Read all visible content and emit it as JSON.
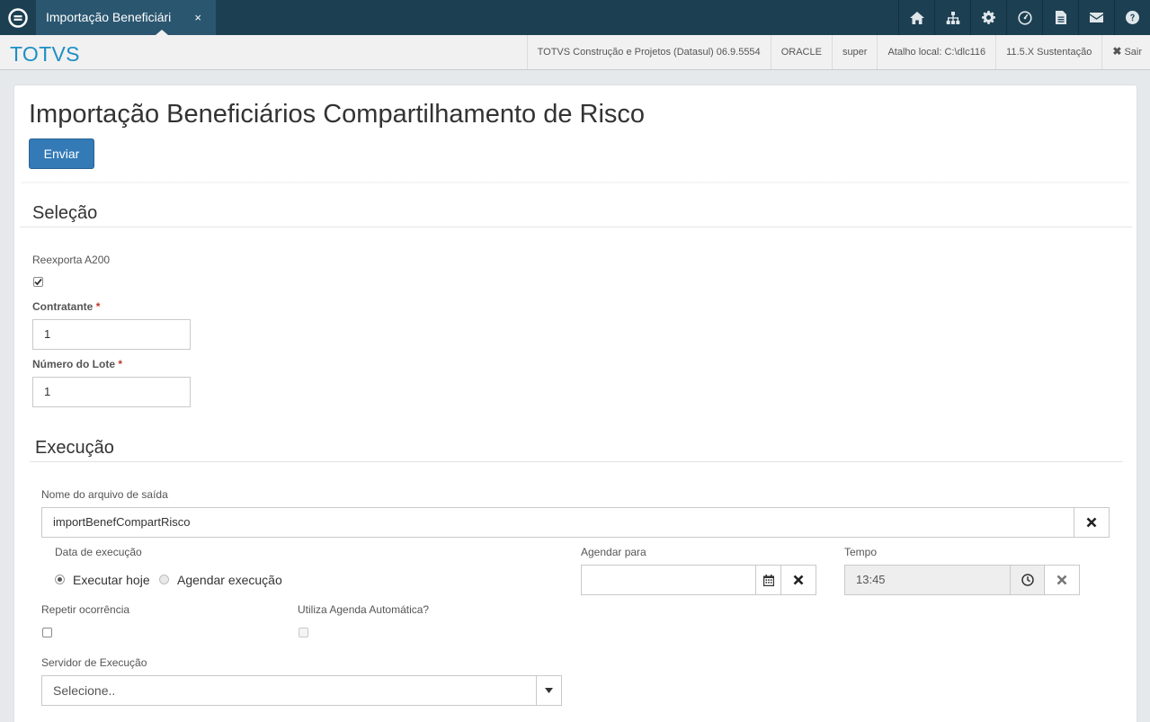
{
  "topbar": {
    "tab_title": "Importação Beneficiári",
    "tab_close": "×",
    "icons": [
      "home-icon",
      "sitemap-icon",
      "gear-icon",
      "dashboard-icon",
      "document-icon",
      "mail-icon",
      "help-icon"
    ]
  },
  "subheader": {
    "brand": "TOTVS",
    "product": "TOTVS Construção e Projetos (Datasul) 06.9.5554",
    "database": "ORACLE",
    "user": "super",
    "shortcut": "Atalho local: C:\\dlc116",
    "version": "11.5.X Sustentação",
    "logout": "Sair"
  },
  "page": {
    "title": "Importação Beneficiários Compartilhamento de Risco",
    "send_label": "Enviar"
  },
  "selecao": {
    "title": "Seleção",
    "reexporta_label": "Reexporta A200",
    "reexporta_checked": true,
    "contratante_label": "Contratante",
    "contratante_value": "1",
    "lote_label": "Número do Lote",
    "lote_value": "1",
    "required_mark": "*"
  },
  "execucao": {
    "title": "Execução",
    "output_label": "Nome do arquivo de saída",
    "output_value": "importBenefCompartRisco",
    "data_label": "Data de execução",
    "radio_today": "Executar hoje",
    "radio_schedule": "Agendar execução",
    "selected_option": "Executar hoje",
    "agendar_label": "Agendar para",
    "agendar_value": "",
    "tempo_label": "Tempo",
    "tempo_value": "13:45",
    "repetir_label": "Repetir ocorrência",
    "repetir_checked": false,
    "agenda_auto_label": "Utiliza Agenda Automática?",
    "agenda_auto_checked": false,
    "servidor_label": "Servidor de Execução",
    "servidor_value": "Selecione.."
  },
  "colors": {
    "topbar": "#1c3f52",
    "tab_active": "#2a5670",
    "brand": "#1d8fc4",
    "primary_button": "#337ab7",
    "required": "#c0392b"
  }
}
